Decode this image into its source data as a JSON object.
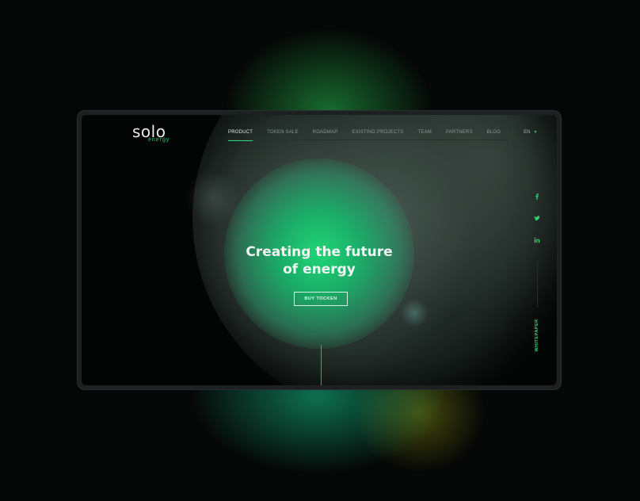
{
  "brand": {
    "logo_main": "solo",
    "logo_sub": "energy",
    "accent": "#2fd673"
  },
  "nav": {
    "items": [
      {
        "label": "PRODUCT",
        "active": true
      },
      {
        "label": "TOKEN SALE"
      },
      {
        "label": "ROADMAP"
      },
      {
        "label": "EXISTING PROJECTS"
      },
      {
        "label": "TEAM"
      },
      {
        "label": "PARTNERS"
      },
      {
        "label": "BLOG"
      }
    ],
    "language": "EN"
  },
  "hero": {
    "headline_line1": "Creating the future",
    "headline_line2": "of energy",
    "cta_label": "BUY TOCKEN"
  },
  "social": [
    "facebook-icon",
    "twitter-icon",
    "linkedin-icon"
  ],
  "side": {
    "whitepaper_label": "WHITEPAPER"
  }
}
